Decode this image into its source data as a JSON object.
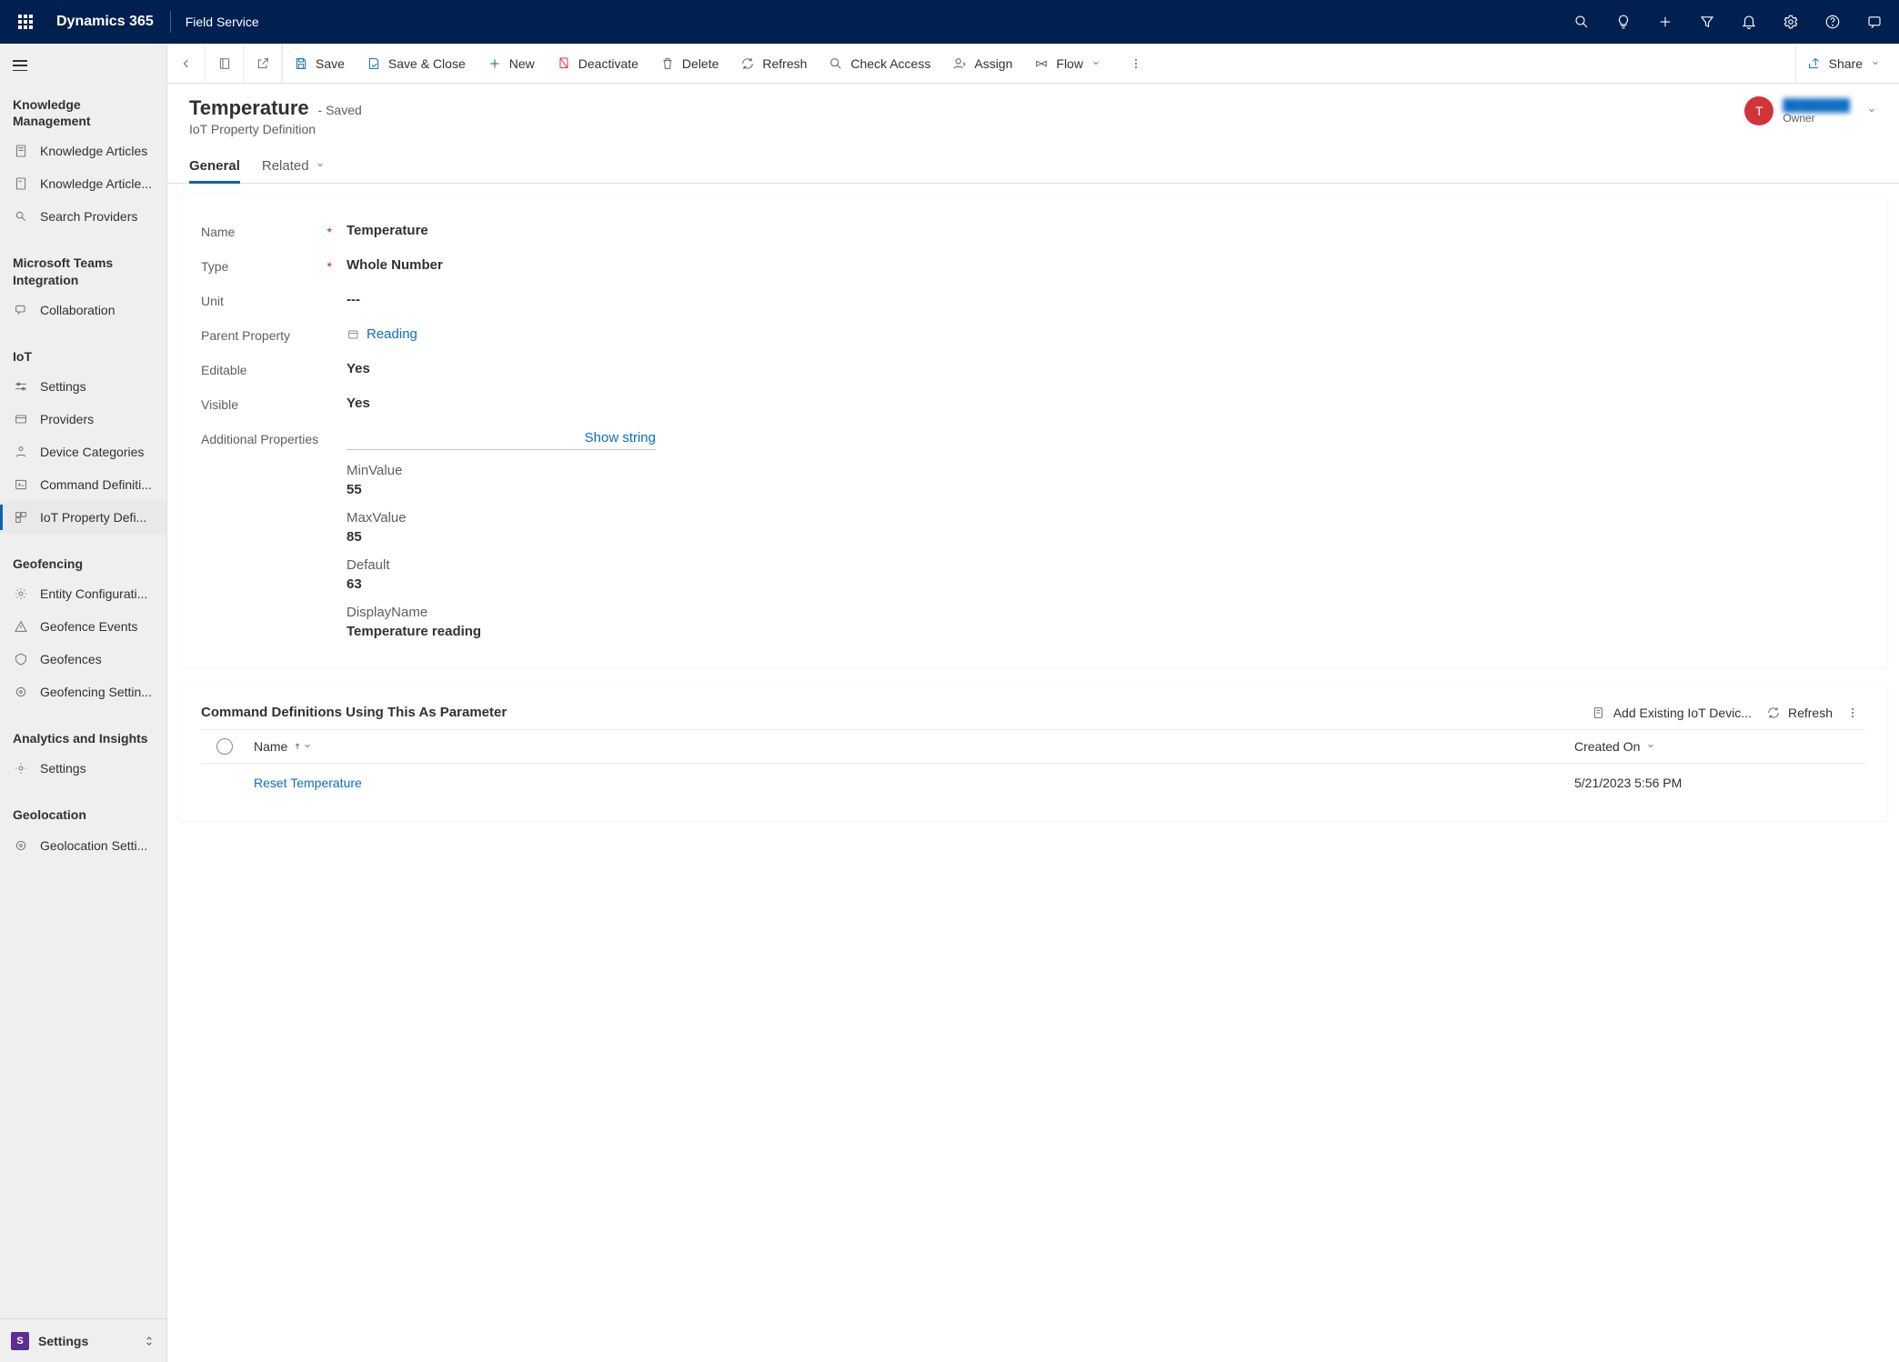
{
  "topbar": {
    "brand": "Dynamics 365",
    "area": "Field Service"
  },
  "sidebar": {
    "groups": [
      {
        "title": "Knowledge Management",
        "items": [
          {
            "label": "Knowledge Articles"
          },
          {
            "label": "Knowledge Article..."
          },
          {
            "label": "Search Providers"
          }
        ]
      },
      {
        "title": "Microsoft Teams Integration",
        "items": [
          {
            "label": "Collaboration"
          }
        ]
      },
      {
        "title": "IoT",
        "items": [
          {
            "label": "Settings"
          },
          {
            "label": "Providers"
          },
          {
            "label": "Device Categories"
          },
          {
            "label": "Command Definiti..."
          },
          {
            "label": "IoT Property Defi...",
            "selected": true
          }
        ]
      },
      {
        "title": "Geofencing",
        "items": [
          {
            "label": "Entity Configurati..."
          },
          {
            "label": "Geofence Events"
          },
          {
            "label": "Geofences"
          },
          {
            "label": "Geofencing Settin..."
          }
        ]
      },
      {
        "title": "Analytics and Insights",
        "items": [
          {
            "label": "Settings"
          }
        ]
      },
      {
        "title": "Geolocation",
        "items": [
          {
            "label": "Geolocation Setti..."
          }
        ]
      }
    ],
    "area_switcher": {
      "badge": "S",
      "label": "Settings"
    }
  },
  "commands": {
    "save": "Save",
    "save_close": "Save & Close",
    "new": "New",
    "deactivate": "Deactivate",
    "delete": "Delete",
    "refresh": "Refresh",
    "check_access": "Check Access",
    "assign": "Assign",
    "flow": "Flow",
    "share": "Share"
  },
  "record": {
    "title": "Temperature",
    "status": "- Saved",
    "subtitle": "IoT Property Definition",
    "owner_initial": "T",
    "owner_name": "████████",
    "owner_label": "Owner"
  },
  "tabs": {
    "general": "General",
    "related": "Related"
  },
  "form": {
    "name_label": "Name",
    "name_value": "Temperature",
    "type_label": "Type",
    "type_value": "Whole Number",
    "unit_label": "Unit",
    "unit_value": "---",
    "parent_label": "Parent Property",
    "parent_value": "Reading",
    "editable_label": "Editable",
    "editable_value": "Yes",
    "visible_label": "Visible",
    "visible_value": "Yes",
    "additional_label": "Additional Properties",
    "show_string": "Show string",
    "props": {
      "min_label": "MinValue",
      "min_value": "55",
      "max_label": "MaxValue",
      "max_value": "85",
      "default_label": "Default",
      "default_value": "63",
      "display_label": "DisplayName",
      "display_value": "Temperature reading"
    }
  },
  "subgrid": {
    "title": "Command Definitions Using This As Parameter",
    "add_existing": "Add Existing IoT Devic...",
    "refresh": "Refresh",
    "col_name": "Name",
    "col_created": "Created On",
    "row_name": "Reset Temperature",
    "row_created": "5/21/2023 5:56 PM"
  }
}
